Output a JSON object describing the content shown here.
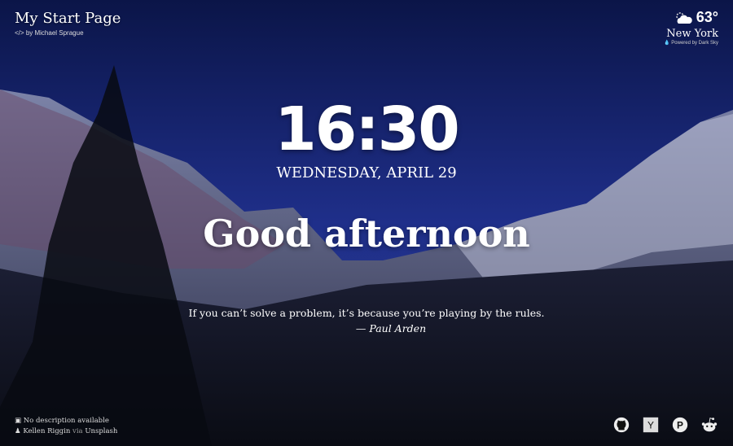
{
  "header": {
    "title": "My Start Page",
    "byline": "by Michael Sprague",
    "code_icon": "</>"
  },
  "weather": {
    "temperature": "63°",
    "city": "New York",
    "powered_by": "Powered by Dark Sky",
    "icon": "partly-cloudy-day-icon"
  },
  "clock": {
    "time": "16:30",
    "date": "WEDNESDAY, APRIL 29"
  },
  "greeting": "Good afternoon",
  "quote": {
    "text": "If you can’t solve a problem, it’s because you’re playing by the rules.",
    "author": "— Paul Arden"
  },
  "photo": {
    "description": "No description available",
    "author": "Kellen Riggin",
    "via": "via",
    "source": "Unsplash"
  },
  "links": [
    {
      "name": "GitHub",
      "icon": "github-icon"
    },
    {
      "name": "Hacker News",
      "icon": "hacker-news-icon"
    },
    {
      "name": "Product Hunt",
      "icon": "product-hunt-icon"
    },
    {
      "name": "Reddit",
      "icon": "reddit-icon"
    }
  ]
}
